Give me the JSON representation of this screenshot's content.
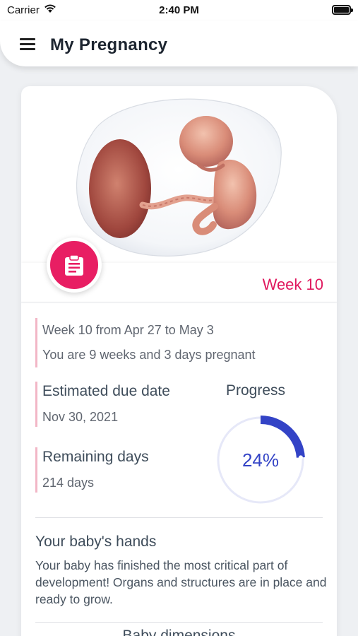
{
  "status_bar": {
    "carrier": "Carrier",
    "time": "2:40 PM"
  },
  "app_bar": {
    "title": "My Pregnancy"
  },
  "colors": {
    "accent_pink": "#e81e63",
    "progress_blue": "#3343c6",
    "progress_track": "#e6e8f8"
  },
  "week_badge": {
    "icon": "clipboard-icon",
    "label": "Week 10"
  },
  "week_info": {
    "range": "Week 10 from Apr 27 to May 3",
    "pregnant_for": "You are 9 weeks and 3 days pregnant"
  },
  "due_date": {
    "label": "Estimated due date",
    "value": "Nov 30, 2021"
  },
  "remaining": {
    "label": "Remaining days",
    "value": "214 days"
  },
  "progress": {
    "title": "Progress",
    "percent_text": "24%",
    "fraction": 0.24
  },
  "section": {
    "title": "Your baby's hands",
    "body": "Your baby has finished the most critical part of development! Organs and structures are in place and ready to grow."
  },
  "next_section": {
    "title": "Baby dimensions"
  }
}
